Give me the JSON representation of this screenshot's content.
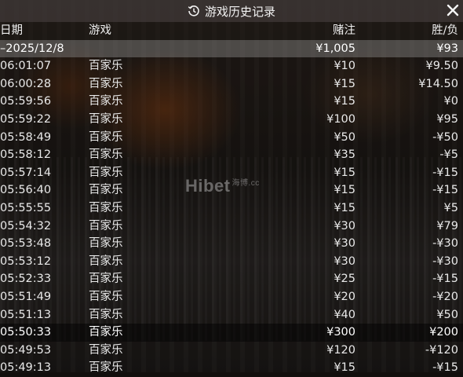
{
  "header": {
    "title": "游戏历史记录"
  },
  "watermark": {
    "brand": "Hibet",
    "sub": "海博.cc"
  },
  "columns": {
    "date": "日期",
    "game": "游戏",
    "bet": "赌注",
    "winloss": "胜/负"
  },
  "date_row": {
    "date": "–2025/12/8",
    "bet": "¥1,005",
    "winloss": "¥93"
  },
  "rows": [
    {
      "time": "06:01:07",
      "game": "百家乐",
      "bet": "¥10",
      "result": "¥9.50"
    },
    {
      "time": "06:00:28",
      "game": "百家乐",
      "bet": "¥15",
      "result": "¥14.50"
    },
    {
      "time": "05:59:56",
      "game": "百家乐",
      "bet": "¥15",
      "result": "¥0"
    },
    {
      "time": "05:59:22",
      "game": "百家乐",
      "bet": "¥100",
      "result": "¥95"
    },
    {
      "time": "05:58:49",
      "game": "百家乐",
      "bet": "¥50",
      "result": "-¥50"
    },
    {
      "time": "05:58:12",
      "game": "百家乐",
      "bet": "¥35",
      "result": "-¥5"
    },
    {
      "time": "05:57:14",
      "game": "百家乐",
      "bet": "¥15",
      "result": "-¥15"
    },
    {
      "time": "05:56:40",
      "game": "百家乐",
      "bet": "¥15",
      "result": "-¥15"
    },
    {
      "time": "05:55:55",
      "game": "百家乐",
      "bet": "¥15",
      "result": "¥5"
    },
    {
      "time": "05:54:32",
      "game": "百家乐",
      "bet": "¥30",
      "result": "¥79"
    },
    {
      "time": "05:53:48",
      "game": "百家乐",
      "bet": "¥30",
      "result": "-¥30"
    },
    {
      "time": "05:53:12",
      "game": "百家乐",
      "bet": "¥30",
      "result": "-¥30"
    },
    {
      "time": "05:52:33",
      "game": "百家乐",
      "bet": "¥25",
      "result": "-¥15"
    },
    {
      "time": "05:51:49",
      "game": "百家乐",
      "bet": "¥20",
      "result": "-¥20"
    },
    {
      "time": "05:51:13",
      "game": "百家乐",
      "bet": "¥40",
      "result": "¥50"
    },
    {
      "time": "05:50:33",
      "game": "百家乐",
      "bet": "¥300",
      "result": "¥200"
    },
    {
      "time": "05:49:53",
      "game": "百家乐",
      "bet": "¥120",
      "result": "-¥120"
    },
    {
      "time": "05:49:13",
      "game": "百家乐",
      "bet": "¥15",
      "result": "-¥15"
    }
  ]
}
